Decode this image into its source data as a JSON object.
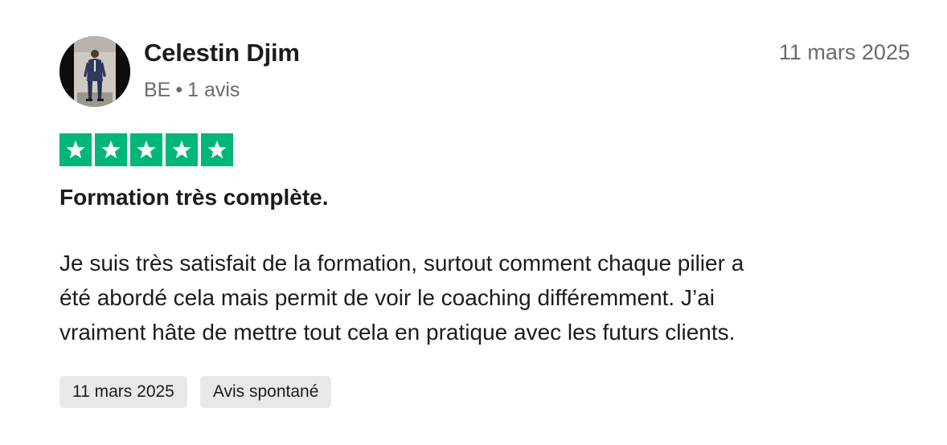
{
  "reviewer": {
    "name": "Celestin Djim",
    "country": "BE",
    "separator": "•",
    "review_count": "1 avis",
    "avatar_icon": "user-photo-avatar"
  },
  "review": {
    "date": "11 mars 2025",
    "rating": 5,
    "rating_max": 5,
    "star_color": "#00b67a",
    "title": "Formation très complète.",
    "body_lines": [
      "Je suis très satisfait de la formation, surtout comment chaque pilier a",
      "été abordé cela mais permit de voir le coaching différemment. J’ai",
      "vraiment hâte de mettre tout cela en pratique avec les futurs clients."
    ]
  },
  "chips": [
    {
      "label": "11 mars 2025"
    },
    {
      "label": "Avis spontané"
    }
  ]
}
